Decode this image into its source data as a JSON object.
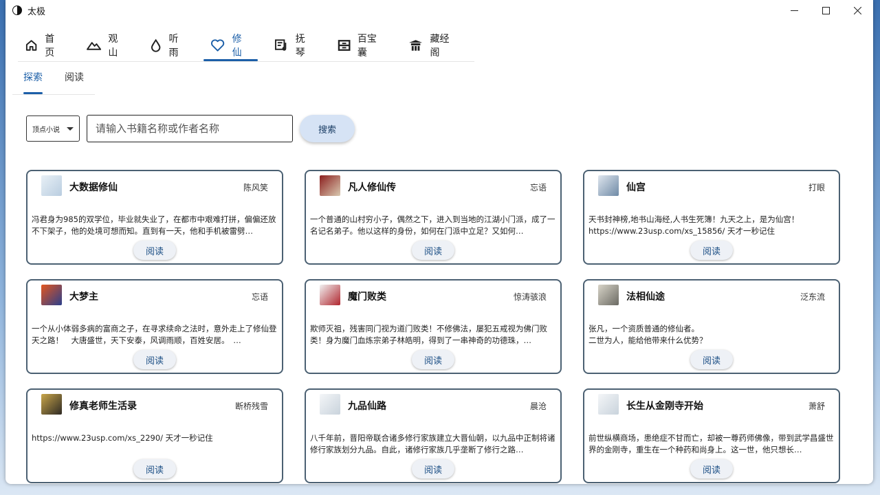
{
  "window": {
    "title": "太极"
  },
  "nav": [
    {
      "label": "首页",
      "icon": "home-icon"
    },
    {
      "label": "观山",
      "icon": "mountain-icon"
    },
    {
      "label": "听雨",
      "icon": "water-drop-icon"
    },
    {
      "label": "修仙",
      "icon": "heart-icon",
      "active": true
    },
    {
      "label": "抚琴",
      "icon": "music-note-icon"
    },
    {
      "label": "百宝囊",
      "icon": "inbox-icon"
    },
    {
      "label": "藏经阁",
      "icon": "temple-icon"
    }
  ],
  "subtabs": [
    {
      "label": "探索",
      "active": true
    },
    {
      "label": "阅读"
    }
  ],
  "search": {
    "source": "顶点小说",
    "placeholder": "请输入书籍名称或作者名称",
    "button": "搜索"
  },
  "read_label": "阅读",
  "books": [
    {
      "title": "大数据修仙",
      "author": "陈风笑",
      "desc": "冯君身为985的双学位，毕业就失业了，在都市中艰难打拼，偏偏还放不下架子，他的处境可想而知。直到有一天，他和手机被雷劈…",
      "cover": [
        "#e8f0f6",
        "#b9cde0"
      ]
    },
    {
      "title": "凡人修仙传",
      "author": "忘语",
      "desc": "一个普通的山村穷小子，偶然之下，进入到当地的江湖小门派，成了一名记名弟子。他以这样的身份，如何在门派中立足？又如何…",
      "cover": [
        "#8b1e1e",
        "#d9c9b0"
      ]
    },
    {
      "title": "仙宫",
      "author": "打眼",
      "desc": "天书封神榜,地书山海经,人书生死簿！九天之上，是为仙宫！\nhttps://www.23usp.com/xs_15856/ 天才一秒记住",
      "cover": [
        "#dfe6ee",
        "#6f8aa6"
      ]
    },
    {
      "title": "大梦主",
      "author": "忘语",
      "desc": "一个从小体弱多病的富商之子，在寻求续命之法时，意外走上了修仙登天之路！　大唐盛世，天下安泰，风调雨顺，百姓安居。　…",
      "cover": [
        "#e3561f",
        "#2b3f8c"
      ]
    },
    {
      "title": "魔门败类",
      "author": "惊涛骇浪",
      "desc": "欺师灭祖，残害同门视为道门败类！不修佛法，屡犯五戒视为佛门败类！身为魔门血炼宗弟子林皓明，得到了一串神奇的功德珠，…",
      "cover": [
        "#f1f1f1",
        "#b0262e"
      ]
    },
    {
      "title": "法相仙途",
      "author": "泛东流",
      "desc": "张凡，一个资质普通的修仙者。\n二世为人，能给他带来什么优势？",
      "cover": [
        "#d8d4c8",
        "#6b6a63"
      ]
    },
    {
      "title": "修真老师生活录",
      "author": "断桥残雪",
      "desc": "https://www.23usp.com/xs_2290/ 天才一秒记住",
      "cover": [
        "#c9a64a",
        "#2e2a24"
      ]
    },
    {
      "title": "九品仙路",
      "author": "晨沧",
      "desc": "八千年前，晋阳帝联合诸多修行家族建立大晋仙朝，以九品中正制将诸修行家族划分九品。自此，诸修行家族几乎垄断了修行之路…",
      "cover": [
        "#f4f6f8",
        "#c9d3dc"
      ]
    },
    {
      "title": "长生从金刚寺开始",
      "author": "萧舒",
      "desc": "前世纵横商场，患绝症不甘而亡，却被一尊药师佛像，带到武学昌盛世界的金刚寺，重生在一个种药和尚身上。这一世，他只想长…",
      "cover": [
        "#f4f6f8",
        "#c9d3dc"
      ]
    }
  ]
}
